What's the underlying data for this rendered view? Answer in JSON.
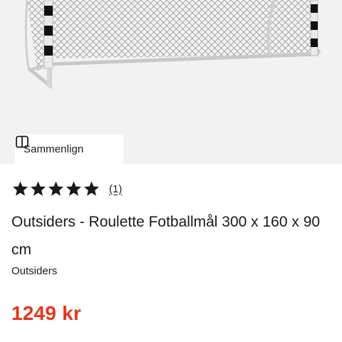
{
  "compare": {
    "label": "Sammenlign",
    "icon": "compare-icon"
  },
  "rating": {
    "value": 5,
    "max": 5,
    "count_label": "(1)",
    "star_color": "#1a1a1a"
  },
  "product": {
    "title": "Outsiders - Roulette Fotballmål 300 x 160 x 90 cm",
    "brand": "Outsiders",
    "price": "1249 kr",
    "price_color": "#e3361b",
    "image": "football-goal-image"
  }
}
